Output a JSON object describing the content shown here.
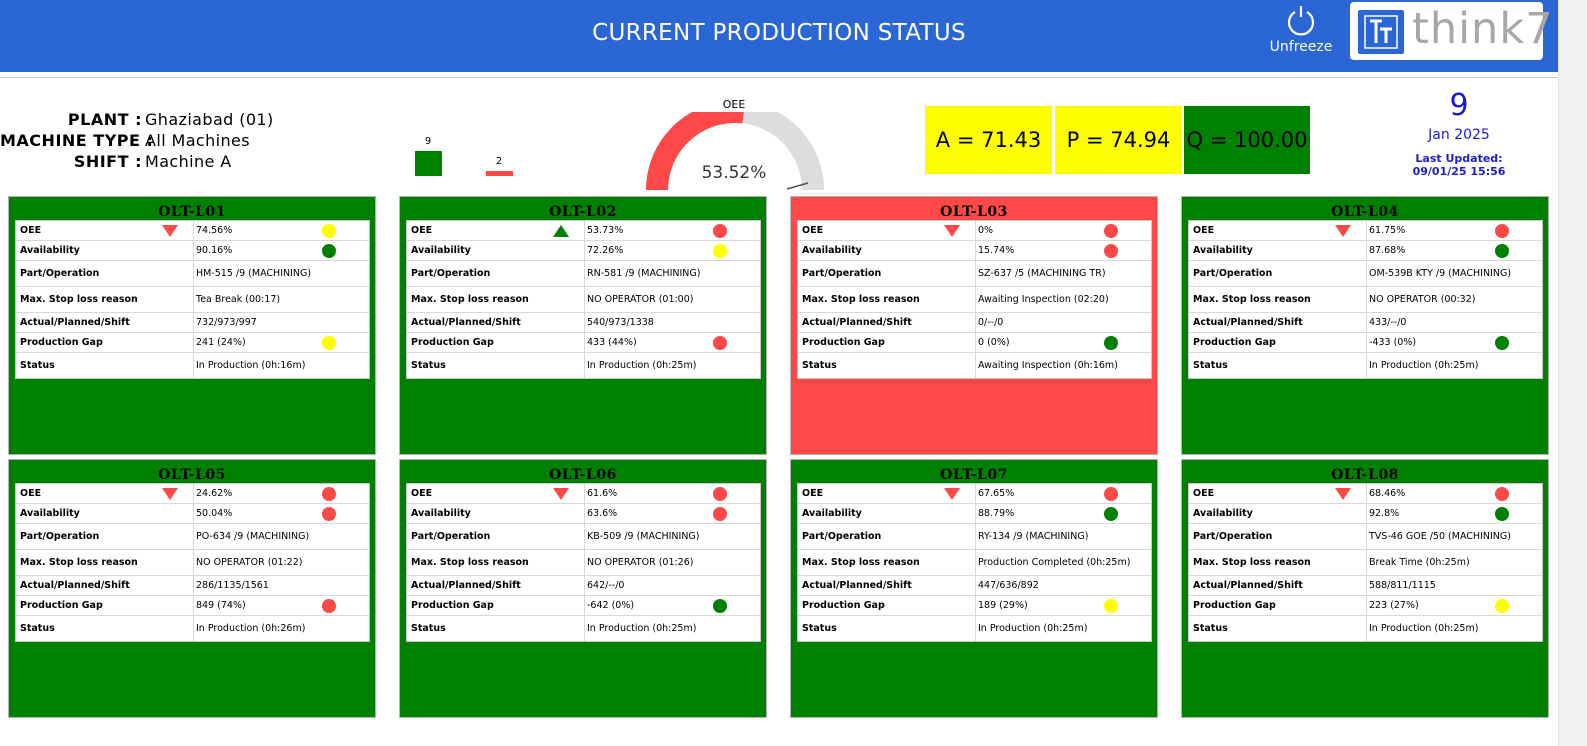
{
  "header": {
    "title": "CURRENT PRODUCTION STATUS",
    "unfreeze_label": "Unfreeze",
    "logo_text": "think7"
  },
  "info": {
    "plant_label": "PLANT :",
    "plant_value": "Ghaziabad (01)",
    "machine_type_label": "MACHINE TYPE :",
    "machine_type_value": "All Machines",
    "shift_label": "SHIFT :",
    "shift_value": "Machine A"
  },
  "legend": {
    "green_count": "9",
    "red_count": "2"
  },
  "gauge": {
    "title": "OEE",
    "value_text": "53.52%",
    "value": 53.52
  },
  "kpis": {
    "a": "A = 71.43",
    "p": "P = 74.94",
    "q": "Q = 100.00"
  },
  "date": {
    "day": "9",
    "month_year": "Jan 2025",
    "updated_label": "Last Updated:",
    "updated_value": "09/01/25 15:56"
  },
  "labels": {
    "oee": "OEE",
    "availability": "Availability",
    "part": "Part/Operation",
    "stop": "Max. Stop loss reason",
    "app": "Actual/Planned/Shift",
    "gap": "Production Gap",
    "status": "Status"
  },
  "colors": {
    "green": "#008000",
    "red": "#ff4848",
    "yellow": "#ffff00",
    "blue": "#2a67d4",
    "gauge_grey": "#dddddd"
  },
  "machines": [
    {
      "name": "OLT-L01",
      "bg": "green",
      "trend": "down",
      "oee": "74.56%",
      "oee_dot": "yellow",
      "availability": "90.16%",
      "avail_dot": "green",
      "part": "HM-515 /9 (MACHINING)",
      "stop": "Tea Break (00:17)",
      "app": "732/973/997",
      "gap": "241 (24%)",
      "gap_dot": "yellow",
      "status": "In Production (0h:16m)"
    },
    {
      "name": "OLT-L02",
      "bg": "green",
      "trend": "up",
      "oee": "53.73%",
      "oee_dot": "red",
      "availability": "72.26%",
      "avail_dot": "yellow",
      "part": "RN-581 /9 (MACHINING)",
      "stop": "NO OPERATOR (01:00)",
      "app": "540/973/1338",
      "gap": "433 (44%)",
      "gap_dot": "red",
      "status": "In Production (0h:25m)"
    },
    {
      "name": "OLT-L03",
      "bg": "red",
      "trend": "down",
      "oee": "0%",
      "oee_dot": "red",
      "availability": "15.74%",
      "avail_dot": "red",
      "part": "SZ-637 /5 (MACHINING TR)",
      "stop": "Awaiting Inspection (02:20)",
      "app": "0/--/0",
      "gap": "0 (0%)",
      "gap_dot": "green",
      "status": "Awaiting Inspection (0h:16m)"
    },
    {
      "name": "OLT-L04",
      "bg": "green",
      "trend": "down",
      "oee": "61.75%",
      "oee_dot": "red",
      "availability": "87.68%",
      "avail_dot": "green",
      "part": "OM-539B KTY /9 (MACHINING)",
      "stop": "NO OPERATOR (00:32)",
      "app": "433/--/0",
      "gap": "-433 (0%)",
      "gap_dot": "green",
      "status": "In Production (0h:25m)"
    },
    {
      "name": "OLT-L05",
      "bg": "green",
      "trend": "down",
      "oee": "24.62%",
      "oee_dot": "red",
      "availability": "50.04%",
      "avail_dot": "red",
      "part": "PO-634 /9 (MACHINING)",
      "stop": "NO OPERATOR (01:22)",
      "app": "286/1135/1561",
      "gap": "849 (74%)",
      "gap_dot": "red",
      "status": "In Production (0h:26m)"
    },
    {
      "name": "OLT-L06",
      "bg": "green",
      "trend": "down",
      "oee": "61.6%",
      "oee_dot": "red",
      "availability": "63.6%",
      "avail_dot": "red",
      "part": "KB-509 /9 (MACHINING)",
      "stop": "NO OPERATOR (01:26)",
      "app": "642/--/0",
      "gap": "-642 (0%)",
      "gap_dot": "green",
      "status": "In Production (0h:25m)"
    },
    {
      "name": "OLT-L07",
      "bg": "green",
      "trend": "down",
      "oee": "67.65%",
      "oee_dot": "red",
      "availability": "88.79%",
      "avail_dot": "green",
      "part": "RY-134 /9 (MACHINING)",
      "stop": "Production Completed (0h:25m)",
      "app": "447/636/892",
      "gap": "189 (29%)",
      "gap_dot": "yellow",
      "status": "In Production (0h:25m)"
    },
    {
      "name": "OLT-L08",
      "bg": "green",
      "trend": "down",
      "oee": "68.46%",
      "oee_dot": "red",
      "availability": "92.8%",
      "avail_dot": "green",
      "part": "TVS-46 GOE /50 (MACHINING)",
      "stop": "Break Time (0h:25m)",
      "app": "588/811/1115",
      "gap": "223 (27%)",
      "gap_dot": "yellow",
      "status": "In Production (0h:25m)"
    }
  ]
}
